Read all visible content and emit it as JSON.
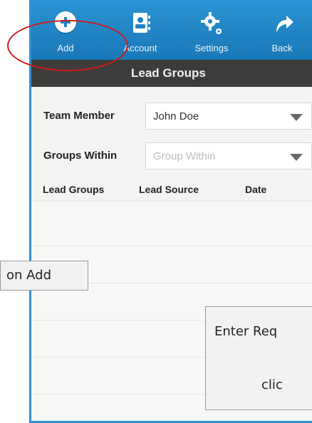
{
  "toolbar": {
    "items": [
      {
        "label": "Add",
        "icon": "plus-circle-icon"
      },
      {
        "label": "Account",
        "icon": "contact-card-icon"
      },
      {
        "label": "Settings",
        "icon": "gear-icon"
      },
      {
        "label": "Back",
        "icon": "back-arrow-icon"
      }
    ]
  },
  "header": {
    "title": "Lead Groups"
  },
  "form": {
    "team_member": {
      "label": "Team Member",
      "value": "John Doe"
    },
    "groups_within": {
      "label": "Groups Within",
      "placeholder": "Group Within"
    }
  },
  "table": {
    "columns": [
      "Lead Groups",
      "Lead Source",
      "Date"
    ],
    "rows": []
  },
  "annotations": {
    "left_callout": "on Add",
    "right_callout_line1": "Enter Req",
    "right_callout_line2": "clic"
  },
  "colors": {
    "toolbar": "#1f84c6",
    "titlebar": "#3c3c3a",
    "highlight_ring": "#d01919",
    "frame": "#2f8fcf"
  }
}
